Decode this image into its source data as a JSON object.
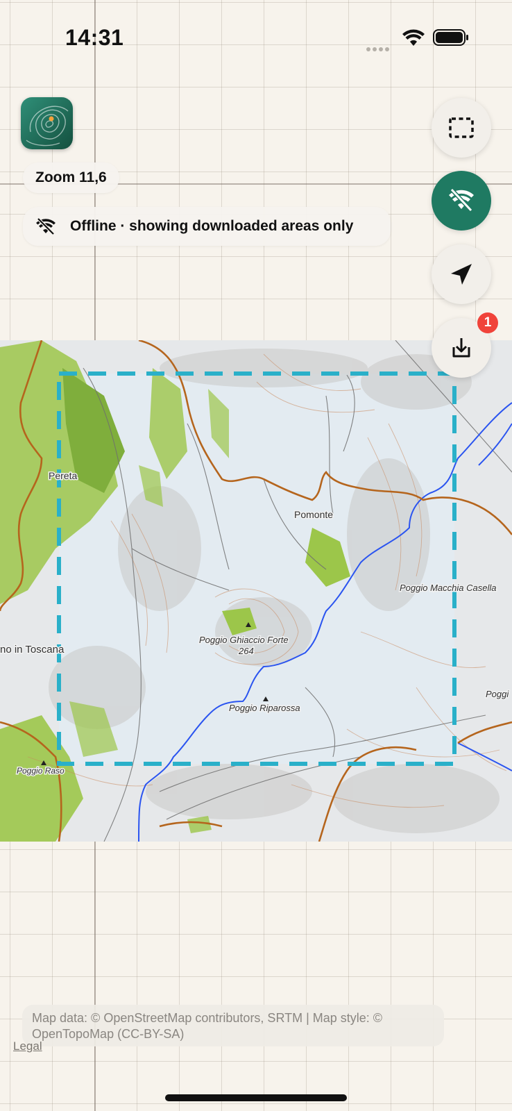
{
  "status_bar": {
    "time": "14:31",
    "wifi_icon": "wifi-icon",
    "battery_icon": "battery-icon"
  },
  "app": {
    "logo_icon": "topo-map-logo-icon"
  },
  "map": {
    "zoom_label": "Zoom 11,6",
    "offline_banner": "Offline · showing downloaded areas only",
    "offline_icon": "wifi-off-icon",
    "place_labels": {
      "pereta": "Pereta",
      "pomonte": "Pomonte",
      "poggio_macchia_casella": "Poggio Macchia Casella",
      "poggio_ghiaccio_forte": "Poggio Ghiaccio Forte",
      "poggio_ghiaccio_forte_elev": "264",
      "no_in_toscana": "no in Toscana",
      "poggio_riparossa": "Poggio Riparossa",
      "poggio_raso": "Poggio Raso",
      "poggio_right": "Poggi"
    },
    "colors": {
      "selection": "#2ab0c9",
      "road": "#b5651d",
      "river": "#2a54f0",
      "forest": "#9cc64a",
      "accent_green": "#1f7a62"
    }
  },
  "controls": {
    "select_area_icon": "dashed-selection-icon",
    "offline_toggle_icon": "wifi-off-icon",
    "locate_icon": "location-arrow-icon",
    "downloads_icon": "download-tray-icon",
    "downloads_badge": "1"
  },
  "attribution": {
    "text": "Map data: © OpenStreetMap contributors, SRTM | Map style: © OpenTopoMap (CC-BY-SA)",
    "legal": "Legal"
  }
}
